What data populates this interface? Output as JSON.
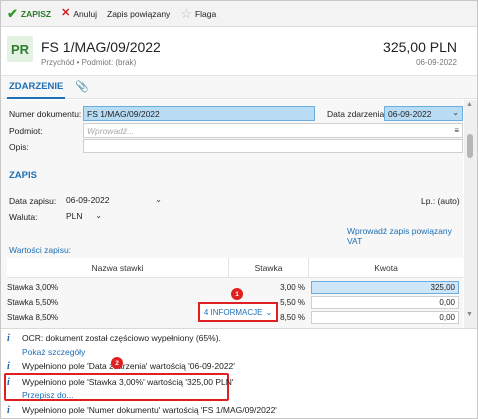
{
  "toolbar": {
    "save_label": "ZAPISZ",
    "cancel_label": "Anuluj",
    "linked_label": "Zapis powiązany",
    "flag_label": "Flaga"
  },
  "header": {
    "badge": "PR",
    "title": "FS 1/MAG/09/2022",
    "subtitle": "Przychód  •  Podmiot: (brak)",
    "amount": "325,00 PLN",
    "date": "06-09-2022"
  },
  "tabs": {
    "event_tab": "ZDARZENIE"
  },
  "event": {
    "doc_number_label": "Numer dokumentu:",
    "doc_number_value": "FS 1/MAG/09/2022",
    "event_date_label": "Data zdarzenia:",
    "event_date_value": "06-09-2022",
    "subject_label": "Podmiot:",
    "subject_placeholder": "Wprowadź...",
    "description_label": "Opis:"
  },
  "entry": {
    "section_title": "ZAPIS",
    "entry_date_label": "Data zapisu:",
    "entry_date_value": "06-09-2022",
    "lp_label": "Lp.: (auto)",
    "currency_label": "Waluta:",
    "currency_value": "PLN",
    "vat_link": "Wprowadź zapis powiązany VAT",
    "values_label": "Wartości zapisu:"
  },
  "table": {
    "headers": [
      "Nazwa stawki",
      "Stawka",
      "Kwota"
    ],
    "rows": [
      {
        "name": "Stawka 3,00%",
        "rate": "3,00 %",
        "amount": "325,00"
      },
      {
        "name": "Stawka 5,50%",
        "rate": "5,50 %",
        "amount": "0,00"
      },
      {
        "name": "Stawka 8,50%",
        "rate": "8,50 %",
        "amount": "0,00"
      }
    ]
  },
  "info_pill": {
    "label": "4 INFORMACJE",
    "marker": "1"
  },
  "notes": {
    "marker": "2",
    "items": [
      {
        "text": "OCR: dokument został częściowo wypełniony (65%).",
        "link": "Pokaż szczegóły"
      },
      {
        "text": "Wypełniono pole 'Data zdarzenia' wartością '06-09-2022'",
        "link": ""
      },
      {
        "text": "Wypełniono pole 'Stawka 3,00%' wartością '325,00 PLN'",
        "link": "Przepisz do..."
      },
      {
        "text": "Wypełniono pole 'Numer dokumentu' wartością 'FS 1/MAG/09/2022'",
        "link": ""
      }
    ]
  },
  "colors": {
    "accent": "#1e6fb5",
    "highlight": "#b9dcf5",
    "alert_red": "#e02020",
    "badge_green": "#2e7d32"
  }
}
